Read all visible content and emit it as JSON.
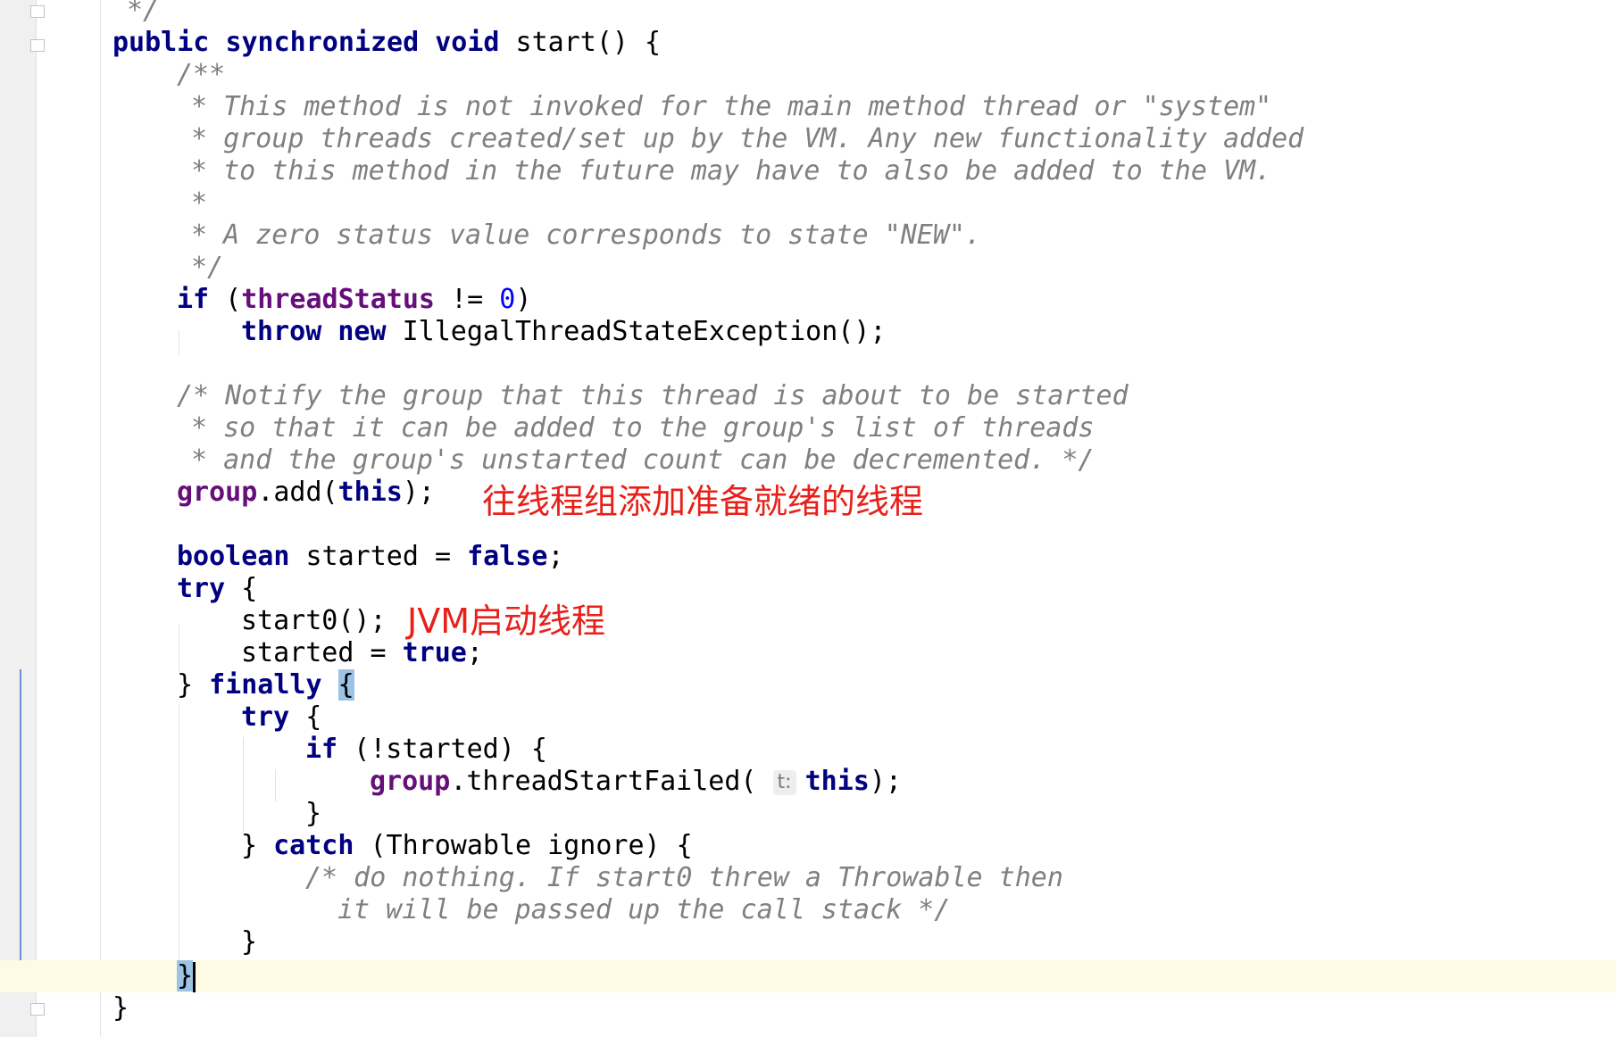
{
  "code": {
    "comment_end": "*/",
    "sig_mod1": "public",
    "sig_mod2": "synchronized",
    "sig_type": "void",
    "sig_rest": " start() {",
    "jd_open": "/**",
    "jd1": "* This method is not invoked for the main method thread or \"system\"",
    "jd2": "* group threads created/set up by the VM. Any new functionality added",
    "jd3": "* to this method in the future may have to also be added to the VM.",
    "jd4": "*",
    "jd5": "* A zero status value corresponds to state \"NEW\".",
    "jd_close": "*/",
    "if_kw": "if",
    "if_open": " (",
    "if_field": "threadStatus",
    "if_op": " != ",
    "if_num": "0",
    "if_close": ")",
    "throw_kw": "throw",
    "new_kw": "new",
    "throw_rest": " IllegalThreadStateException();",
    "c1": "/* Notify the group that this thread is about to be started",
    "c2": "* so that it can be added to the group's list of threads",
    "c3": "* and the group's unstarted count can be decremented. */",
    "grp_field": "group",
    "grp_mid": ".add(",
    "this_kw": "this",
    "grp_end": ");",
    "bool_kw": "boolean",
    "bool_mid": " started = ",
    "false_kw": "false",
    "semi": ";",
    "try_kw": "try",
    "open_brace": " {",
    "start0": "start0();",
    "started_assign": "started = ",
    "true_kw": "true",
    "close_brace_lead": "} ",
    "finally_kw": "finally",
    "space": " ",
    "lbrace": "{",
    "ifn_rest": " (!started) {",
    "tsf_mid": ".threadStartFailed(",
    "hint_t": "t:",
    "rbrace": "}",
    "catch_kw": "catch",
    "catch_rest": " (Throwable ignore) {",
    "c4": "/* do nothing. If start0 threw a Throwable then",
    "c5": "it will be passed up the call stack */"
  },
  "annotations": {
    "group_add": "往线程组添加准备就绪的线程",
    "start0": "JVM启动线程"
  },
  "colors": {
    "keyword": "#000080",
    "field": "#660e7a",
    "number": "#0000ff",
    "comment": "#808080",
    "annotation": "#e8201a",
    "current_line": "#fdfbe3",
    "brace_match": "#9cc3e6"
  }
}
